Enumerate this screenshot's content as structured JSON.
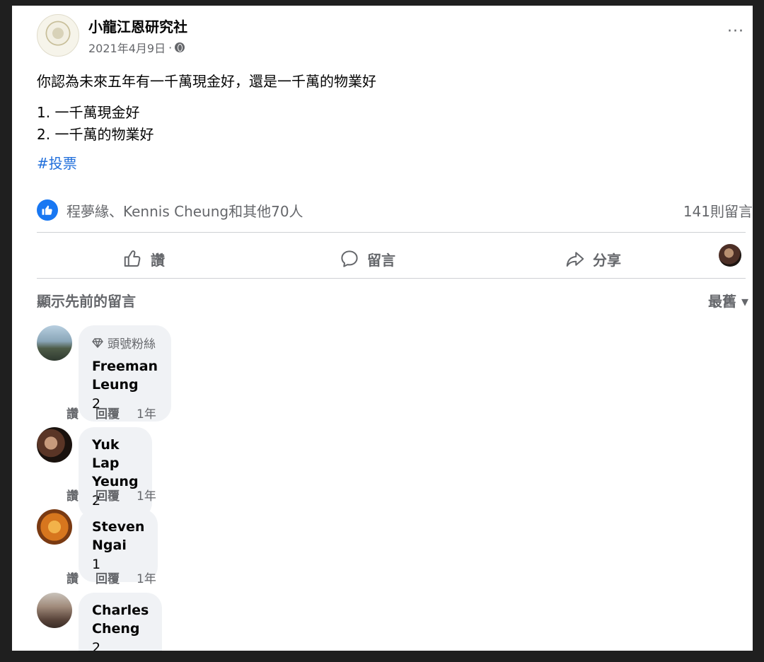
{
  "post": {
    "page_name": "小龍江恩研究社",
    "date": "2021年4月9日",
    "meta_separator": "·",
    "more": "···",
    "body_line": "你認為未來五年有一千萬現金好，還是一千萬的物業好",
    "options": [
      "1. 一千萬現金好",
      "2. 一千萬的物業好"
    ],
    "hashtag": "#投票"
  },
  "reactions": {
    "text": "程夢緣、Kennis Cheung和其他70人",
    "comments_count": "141則留言"
  },
  "actions": {
    "like": "讚",
    "comment": "留言",
    "share": "分享"
  },
  "comments_header": {
    "previous": "顯示先前的留言",
    "sort": "最舊 ▾"
  },
  "comments": [
    {
      "badge": "頭號粉絲",
      "name": "Freeman Leung",
      "text": "2",
      "like": "讚",
      "reply": "回覆",
      "time": "1年"
    },
    {
      "badge": "",
      "name": "Yuk Lap Yeung",
      "text": "2",
      "like": "讚",
      "reply": "回覆",
      "time": "1年"
    },
    {
      "badge": "",
      "name": "Steven Ngai",
      "text": "1",
      "like": "讚",
      "reply": "回覆",
      "time": "1年"
    },
    {
      "badge": "",
      "name": "Charles Cheng",
      "text": "2",
      "like": "",
      "reply": "",
      "time": ""
    }
  ],
  "colors": {
    "link": "#216fdb",
    "like_blue": "#1877f2",
    "secondary_text": "#65676b",
    "bubble": "#f0f2f5"
  },
  "icons": [
    "globe-icon",
    "more-icon",
    "like-reaction-icon",
    "thumbs-up-icon",
    "comment-icon",
    "share-icon",
    "diamond-icon"
  ]
}
